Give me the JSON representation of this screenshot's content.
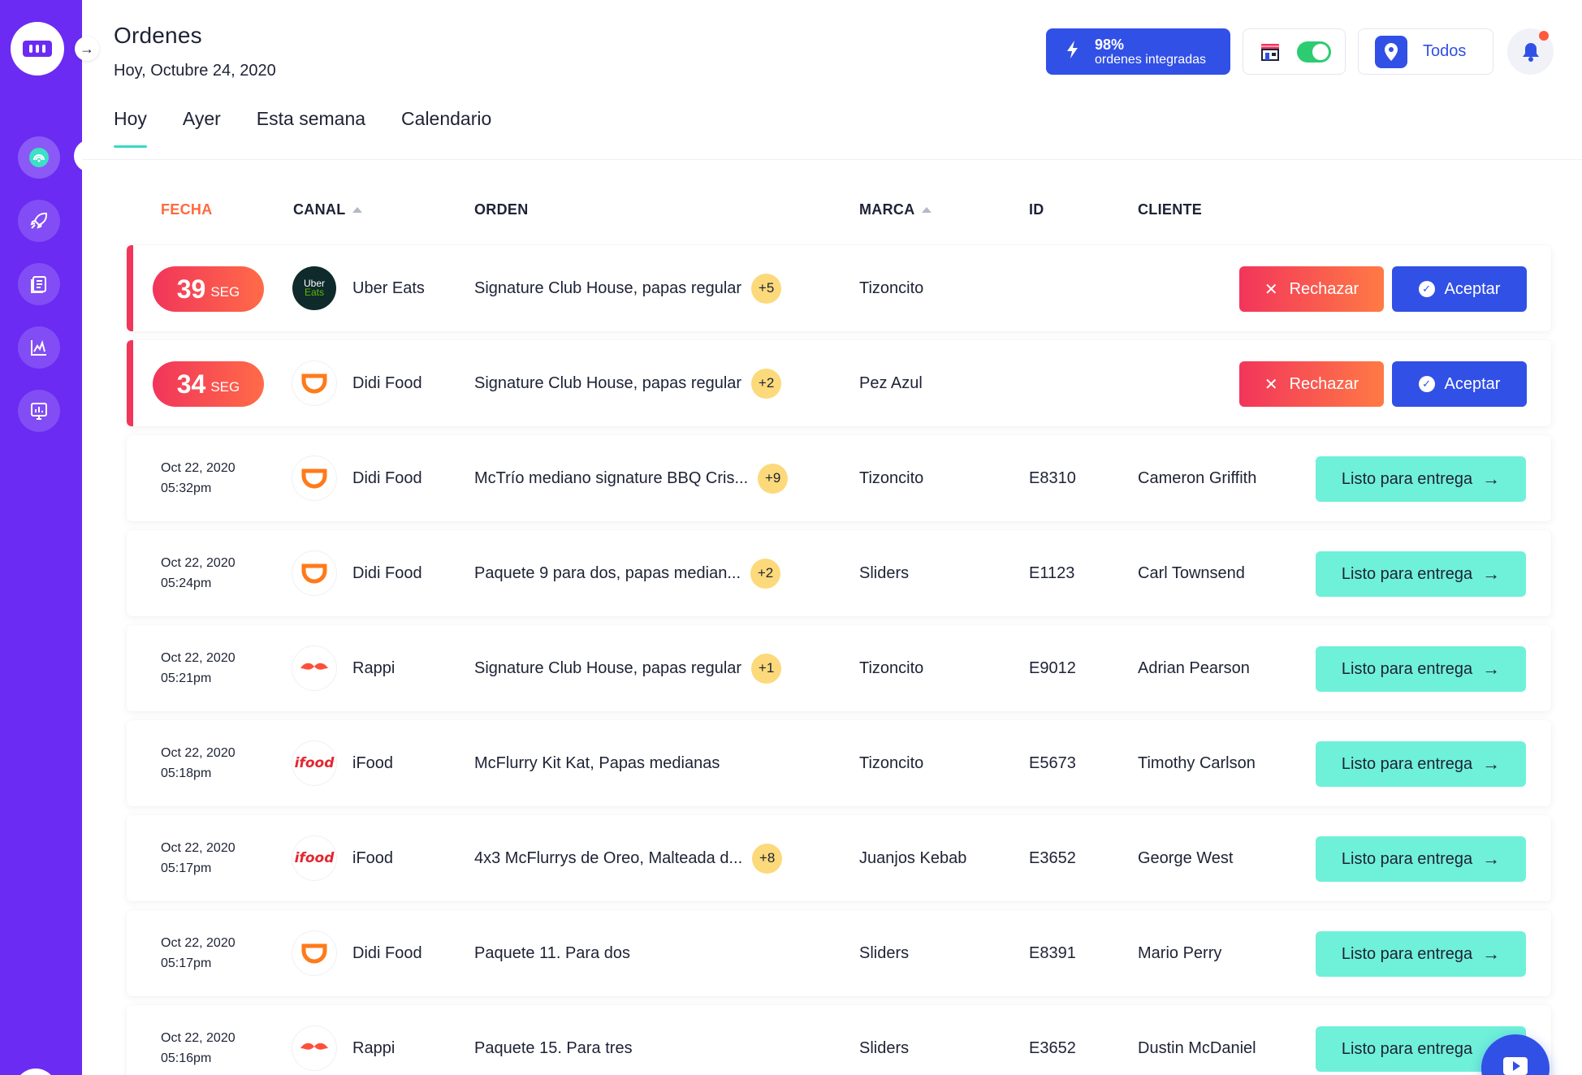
{
  "header": {
    "title": "Ordenes",
    "date": "Hoy, Octubre 24, 2020",
    "integration": {
      "percent": "98%",
      "label": "ordenes integradas"
    },
    "store_toggle_on": true,
    "location_filter": "Todos",
    "notifications_unread": true
  },
  "tabs": [
    {
      "label": "Hoy",
      "active": true
    },
    {
      "label": "Ayer",
      "active": false
    },
    {
      "label": "Esta semana",
      "active": false
    },
    {
      "label": "Calendario",
      "active": false
    }
  ],
  "table": {
    "headers": {
      "fecha": "FECHA",
      "canal": "CANAL",
      "orden": "ORDEN",
      "marca": "MARCA",
      "id": "ID",
      "cliente": "CLIENTE"
    },
    "reject_label": "Rechazar",
    "accept_label": "Aceptar",
    "ready_label": "Listo para entrega",
    "timer_unit": "SEG",
    "pending": [
      {
        "seconds": "39",
        "channel": "Uber Eats",
        "logo": "uber",
        "order": "Signature Club House, papas regular",
        "extra": "+5",
        "brand": "Tizoncito"
      },
      {
        "seconds": "34",
        "channel": "Didi Food",
        "logo": "didi",
        "order": "Signature Club House, papas regular",
        "extra": "+2",
        "brand": "Pez Azul"
      }
    ],
    "orders": [
      {
        "date": "Oct 22, 2020",
        "time": "05:32pm",
        "channel": "Didi Food",
        "logo": "didi",
        "order": "McTrío mediano signature BBQ Cris...",
        "extra": "+9",
        "brand": "Tizoncito",
        "id": "E8310",
        "customer": "Cameron Griffith"
      },
      {
        "date": "Oct 22, 2020",
        "time": "05:24pm",
        "channel": "Didi Food",
        "logo": "didi",
        "order": "Paquete 9 para dos, papas median...",
        "extra": "+2",
        "brand": "Sliders",
        "id": "E1123",
        "customer": "Carl Townsend"
      },
      {
        "date": "Oct 22, 2020",
        "time": "05:21pm",
        "channel": "Rappi",
        "logo": "rappi",
        "order": "Signature Club House, papas regular",
        "extra": "+1",
        "brand": "Tizoncito",
        "id": "E9012",
        "customer": "Adrian Pearson"
      },
      {
        "date": "Oct 22, 2020",
        "time": "05:18pm",
        "channel": "iFood",
        "logo": "ifood",
        "order": "McFlurry Kit Kat, Papas medianas",
        "extra": "",
        "brand": "Tizoncito",
        "id": "E5673",
        "customer": "Timothy Carlson"
      },
      {
        "date": "Oct 22, 2020",
        "time": "05:17pm",
        "channel": "iFood",
        "logo": "ifood",
        "order": "4x3 McFlurrys de Oreo, Malteada d...",
        "extra": "+8",
        "brand": "Juanjos Kebab",
        "id": "E3652",
        "customer": "George West"
      },
      {
        "date": "Oct 22, 2020",
        "time": "05:17pm",
        "channel": "Didi Food",
        "logo": "didi",
        "order": "Paquete 11. Para dos",
        "extra": "",
        "brand": "Sliders",
        "id": "E8391",
        "customer": "Mario Perry"
      },
      {
        "date": "Oct 22, 2020",
        "time": "05:16pm",
        "channel": "Rappi",
        "logo": "rappi",
        "order": "Paquete 15. Para tres",
        "extra": "",
        "brand": "Sliders",
        "id": "E3652",
        "customer": "Dustin McDaniel"
      }
    ]
  },
  "logo_text": {
    "uber_top": "Uber",
    "uber_bottom": "Eats",
    "ifood": "ifood"
  },
  "colors": {
    "sidebar": "#6b2bf2",
    "primary": "#3150e6",
    "accent": "#38d9c4",
    "ready": "#6ff0d9",
    "danger": "#f2355b",
    "badge": "#fcd97a"
  },
  "sidebar_icons": [
    "live-orders-icon",
    "rocket-icon",
    "menu-book-icon",
    "analytics-icon",
    "reports-icon"
  ]
}
